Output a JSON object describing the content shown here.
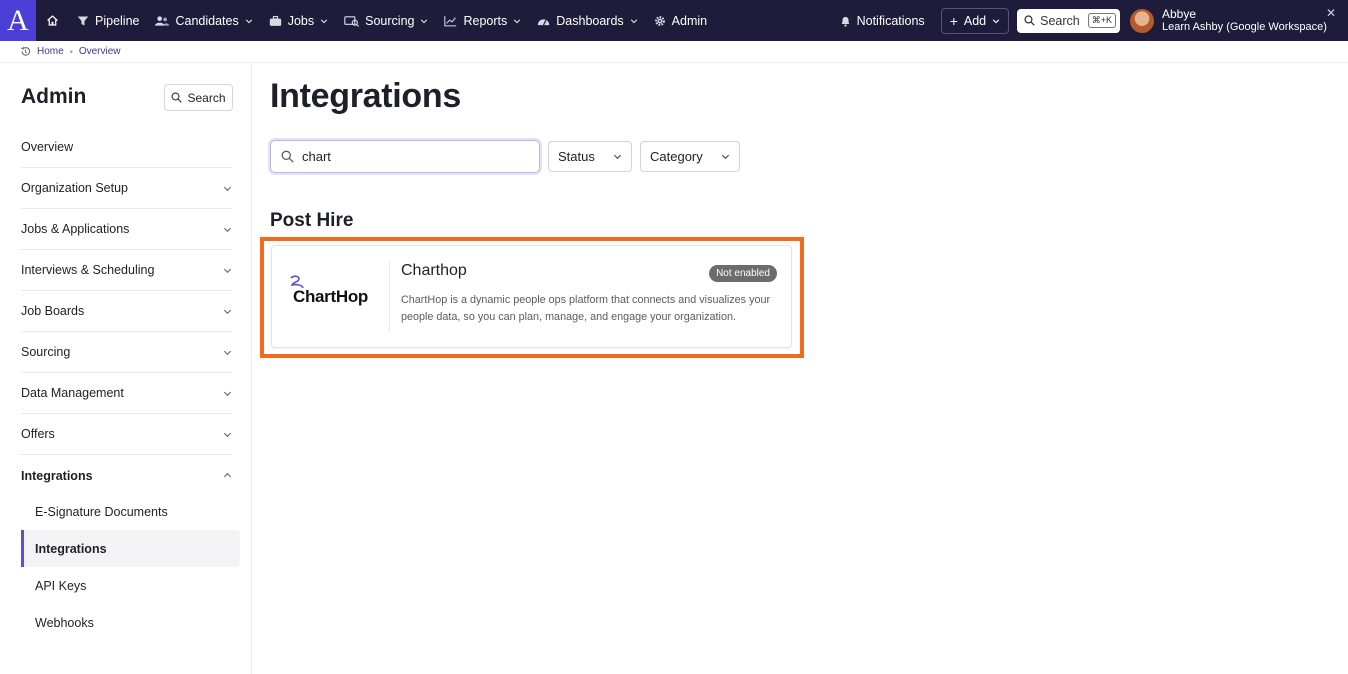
{
  "topnav": {
    "logo_letter": "A",
    "items": [
      {
        "label": "Pipeline"
      },
      {
        "label": "Candidates"
      },
      {
        "label": "Jobs"
      },
      {
        "label": "Sourcing"
      },
      {
        "label": "Reports"
      },
      {
        "label": "Dashboards"
      },
      {
        "label": "Admin"
      }
    ],
    "notifications_label": "Notifications",
    "add_label": "Add",
    "search_label": "Search",
    "search_shortcut": "⌘+K",
    "user_name": "Abbye",
    "user_org": "Learn Ashby (Google Workspace)"
  },
  "breadcrumb": {
    "items": [
      "Home",
      "Overview"
    ]
  },
  "sidebar": {
    "title": "Admin",
    "search_label": "Search",
    "items": [
      {
        "label": "Overview"
      },
      {
        "label": "Organization Setup"
      },
      {
        "label": "Jobs & Applications"
      },
      {
        "label": "Interviews & Scheduling"
      },
      {
        "label": "Job Boards"
      },
      {
        "label": "Sourcing"
      },
      {
        "label": "Data Management"
      },
      {
        "label": "Offers"
      },
      {
        "label": "Integrations"
      }
    ],
    "subitems": [
      {
        "label": "E-Signature Documents"
      },
      {
        "label": "Integrations"
      },
      {
        "label": "API Keys"
      },
      {
        "label": "Webhooks"
      }
    ]
  },
  "main": {
    "title": "Integrations",
    "search_value": "chart",
    "status_label": "Status",
    "category_label": "Category",
    "section_title": "Post Hire",
    "card": {
      "logo_text": "ChartHop",
      "name": "Charthop",
      "badge": "Not enabled",
      "description": "ChartHop is a dynamic people ops platform that connects and visualizes your people data, so you can plan, manage, and engage your organization."
    }
  },
  "colors": {
    "nav_bg": "#1e1c3a",
    "brand": "#4b3fd6",
    "highlight": "#f26a1b",
    "active_indicator": "#5b4fd6"
  }
}
